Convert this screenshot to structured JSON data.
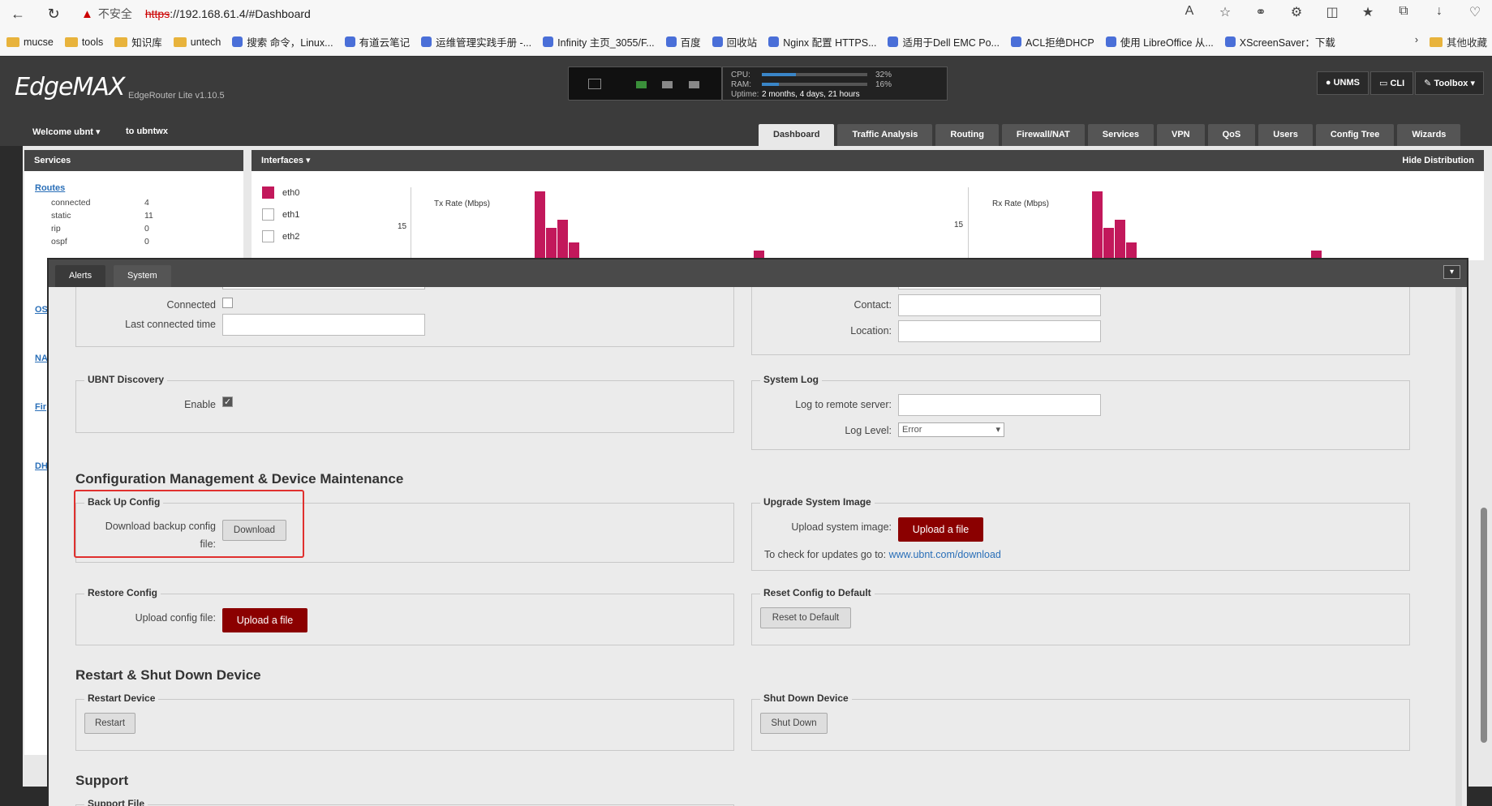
{
  "browser": {
    "insecure_label": "不安全",
    "url_https": "https",
    "url_rest": "://192.168.61.4/#Dashboard",
    "bookmarks": [
      "mucse",
      "tools",
      "知识库",
      "untech",
      "搜索 命令，Linux...",
      "有道云笔记",
      "运维管理实践手册 -...",
      "Infinity 主页_3055/F...",
      "百度",
      "回收站",
      "Nginx 配置 HTTPS...",
      "适用于Dell EMC Po...",
      "ACL拒绝DHCP",
      "使用 LibreOffice 从...",
      "XScreenSaver：下载"
    ],
    "other_bookmarks": "其他收藏"
  },
  "header": {
    "logo": "EdgeMAX",
    "version": "EdgeRouter Lite v1.10.5",
    "cpu_label": "CPU:",
    "cpu_value": "32%",
    "cpu_fraction": 0.32,
    "ram_label": "RAM:",
    "ram_value": "16%",
    "ram_fraction": 0.16,
    "uptime_label": "Uptime:",
    "uptime_value": "2 months, 4 days, 21 hours",
    "buttons": {
      "unms": "UNMS",
      "cli": "CLI",
      "toolbox": "Toolbox"
    }
  },
  "nav": {
    "welcome": "Welcome ubnt",
    "to_user": "to ubntwx",
    "tabs": [
      "Dashboard",
      "Traffic Analysis",
      "Routing",
      "Firewall/NAT",
      "Services",
      "VPN",
      "QoS",
      "Users",
      "Config Tree",
      "Wizards"
    ]
  },
  "services_panel": {
    "title": "Services",
    "routes_title": "Routes",
    "routes": [
      {
        "name": "connected",
        "value": "4"
      },
      {
        "name": "static",
        "value": "11"
      },
      {
        "name": "rip",
        "value": "0"
      },
      {
        "name": "ospf",
        "value": "0"
      }
    ],
    "side_links": [
      "OS",
      "NA",
      "Fir",
      "DH"
    ]
  },
  "interfaces_panel": {
    "title": "Interfaces",
    "hide_distribution": "Hide Distribution",
    "interfaces": [
      "eth0",
      "eth1",
      "eth2"
    ],
    "tx_title": "Tx Rate (Mbps)",
    "rx_title": "Rx Rate (Mbps)",
    "tick": "15"
  },
  "modal": {
    "tabs": [
      "Alerts",
      "System"
    ],
    "connected_label": "Connected",
    "last_connected_label": "Last connected time",
    "contact_label": "Contact:",
    "location_label": "Location:",
    "ubnt_discovery_title": "UBNT Discovery",
    "enable_label": "Enable",
    "system_log_title": "System Log",
    "log_remote_label": "Log to remote server:",
    "log_level_label": "Log Level:",
    "log_level_value": "Error",
    "config_section": "Configuration Management & Device Maintenance",
    "backup_title": "Back Up Config",
    "backup_label_1": "Download backup config",
    "backup_label_2": "file:",
    "download_btn": "Download",
    "upgrade_title": "Upgrade System Image",
    "upload_image_label": "Upload system image:",
    "upload_btn": "Upload a file",
    "check_updates_text": "To check for updates go to:",
    "check_updates_link": "www.ubnt.com/download",
    "restore_title": "Restore Config",
    "upload_config_label": "Upload config file:",
    "reset_title": "Reset Config to Default",
    "reset_btn": "Reset to Default",
    "restart_section": "Restart & Shut Down Device",
    "restart_title": "Restart Device",
    "restart_btn": "Restart",
    "shutdown_title": "Shut Down Device",
    "shutdown_btn": "Shut Down",
    "support_section": "Support",
    "support_file_title": "Support File"
  }
}
